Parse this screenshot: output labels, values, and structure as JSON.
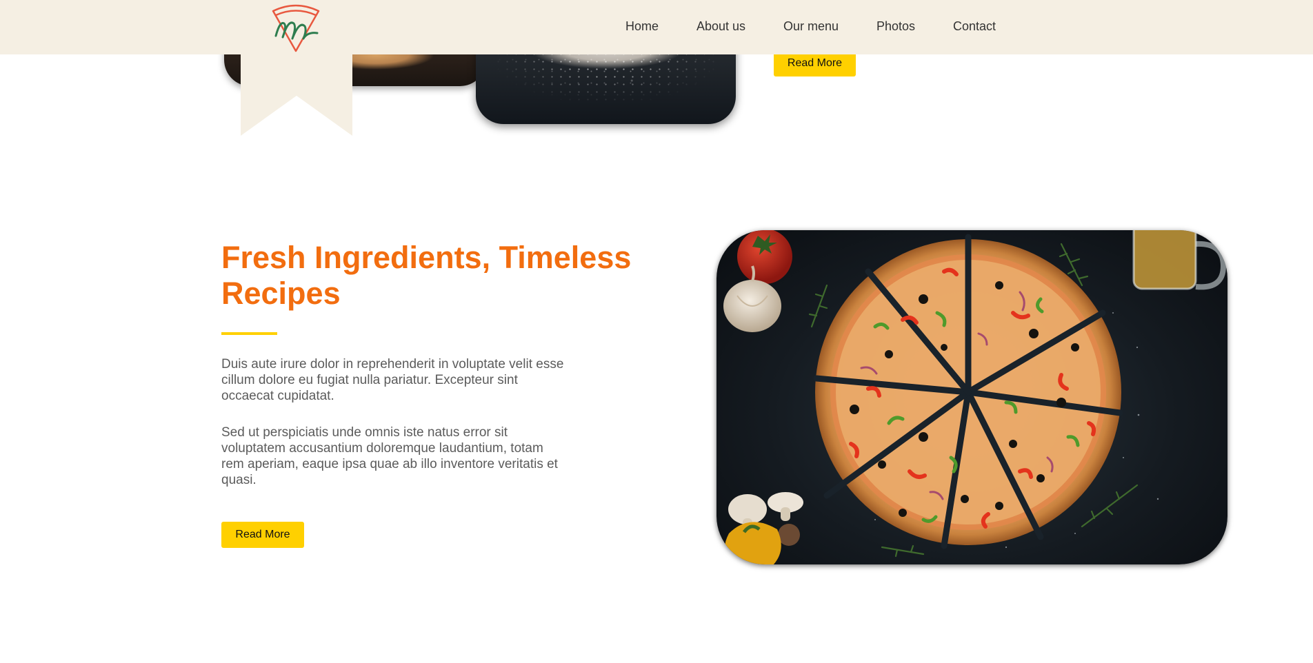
{
  "nav": {
    "items": [
      "Home",
      "About us",
      "Our menu",
      "Photos",
      "Contact"
    ]
  },
  "previous_section": {
    "read_more_label": "Read More"
  },
  "section": {
    "title": "Fresh Ingredients, Timeless Recipes",
    "paragraph_1": "Duis aute irure dolor in reprehenderit in voluptate velit esse cillum dolore eu fugiat nulla pariatur. Excepteur sint occaecat cupidatat.",
    "paragraph_2": "Sed ut perspiciatis unde omnis iste natus error sit voluptatem accusantium doloremque laudantium, totam rem aperiam, eaque ipsa quae ab illo inventore veritatis et quasi.",
    "read_more_label": "Read More"
  },
  "colors": {
    "header_bg": "#f5efe3",
    "accent_orange": "#f26d0f",
    "button_yellow": "#ffd000",
    "logo_red": "#e8583f",
    "logo_green": "#2e7d4f"
  },
  "icons": {
    "logo": "pizza-slice-m-logo"
  }
}
